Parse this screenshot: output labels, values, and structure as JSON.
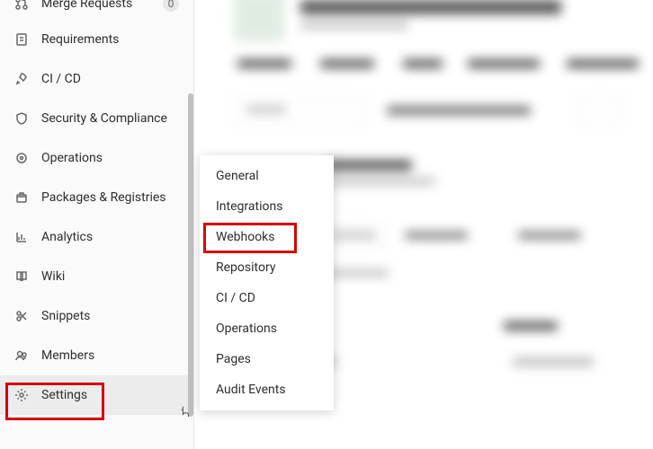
{
  "sidebar": {
    "items": [
      {
        "label": "Merge Requests",
        "badge": "0"
      },
      {
        "label": "Requirements"
      },
      {
        "label": "CI / CD"
      },
      {
        "label": "Security & Compliance"
      },
      {
        "label": "Operations"
      },
      {
        "label": "Packages & Registries"
      },
      {
        "label": "Analytics"
      },
      {
        "label": "Wiki"
      },
      {
        "label": "Snippets"
      },
      {
        "label": "Members"
      },
      {
        "label": "Settings"
      }
    ]
  },
  "submenu": {
    "items": [
      {
        "label": "General"
      },
      {
        "label": "Integrations"
      },
      {
        "label": "Webhooks"
      },
      {
        "label": "Repository"
      },
      {
        "label": "CI / CD"
      },
      {
        "label": "Operations"
      },
      {
        "label": "Pages"
      },
      {
        "label": "Audit Events"
      }
    ]
  }
}
